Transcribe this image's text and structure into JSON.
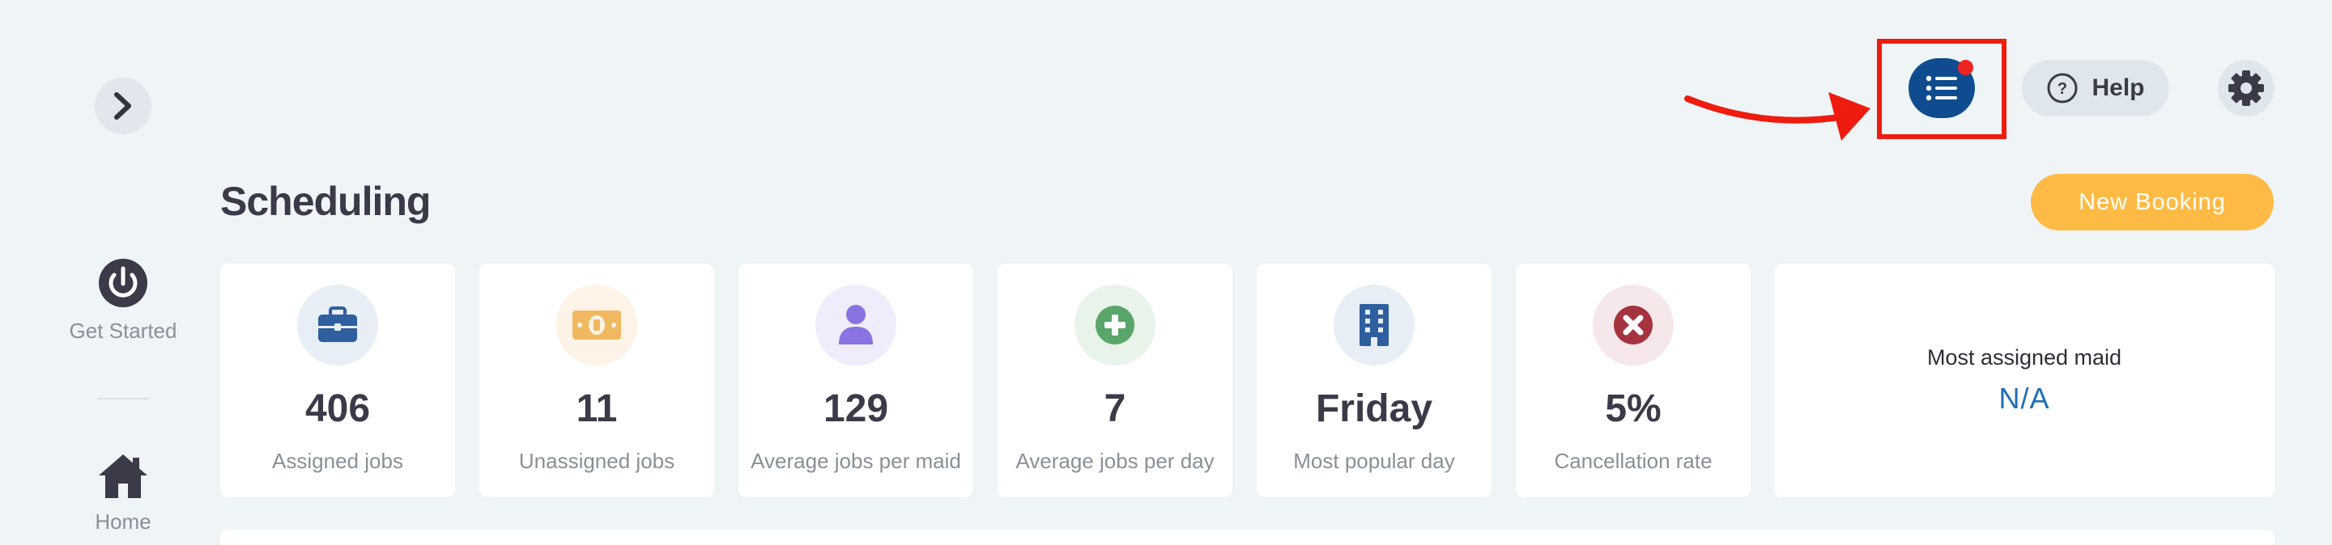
{
  "sidebar": {
    "items": [
      {
        "label": "Get Started",
        "icon": "power-icon"
      },
      {
        "label": "Home",
        "icon": "home-icon"
      }
    ]
  },
  "header": {
    "title": "Scheduling",
    "help_label": "Help",
    "new_booking_label": "New Booking"
  },
  "stats": [
    {
      "value": "406",
      "caption": "Assigned jobs",
      "icon": "briefcase-icon",
      "icon_color": "#2f5f9e",
      "bg": "#e7eef5"
    },
    {
      "value": "11",
      "caption": "Unassigned jobs",
      "icon": "money-icon",
      "icon_color": "#f0b860",
      "bg": "#fdf3e6"
    },
    {
      "value": "129",
      "caption": "Average jobs per maid",
      "icon": "user-icon",
      "icon_color": "#8a72e0",
      "bg": "#efecfb"
    },
    {
      "value": "7",
      "caption": "Average jobs per day",
      "icon": "plus-circle-icon",
      "icon_color": "#5aa56a",
      "bg": "#e8f3ea"
    },
    {
      "value": "Friday",
      "caption": "Most popular day",
      "icon": "building-icon",
      "icon_color": "#2f5f9e",
      "bg": "#e7eef5"
    },
    {
      "value": "5%",
      "caption": "Cancellation rate",
      "icon": "x-circle-icon",
      "icon_color": "#a63340",
      "bg": "#f6e8ea"
    }
  ],
  "most_assigned": {
    "label": "Most assigned maid",
    "value": "N/A"
  },
  "colors": {
    "accent": "#0f4c8f",
    "new_booking": "#fdbb46",
    "highlight": "#ee1c0e"
  }
}
